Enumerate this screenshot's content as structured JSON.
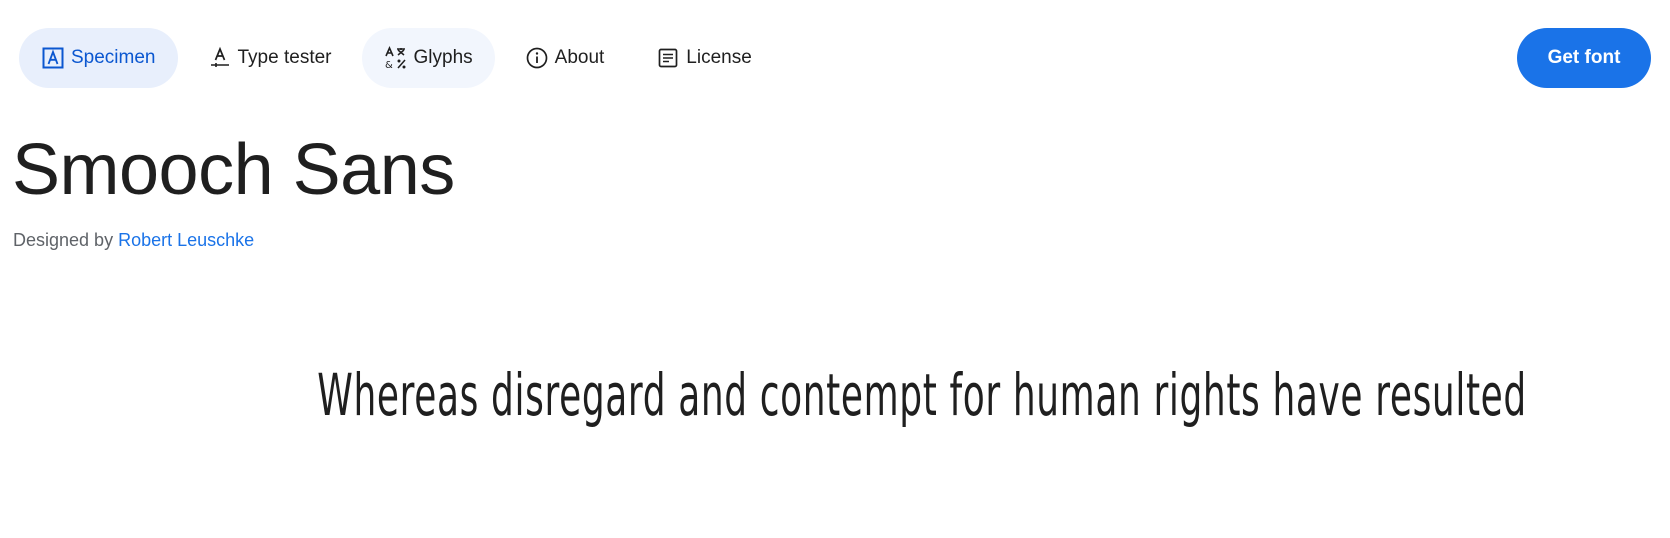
{
  "nav": {
    "tabs": [
      {
        "label": "Specimen",
        "icon": "specimen-icon",
        "active": true
      },
      {
        "label": "Type tester",
        "icon": "type-tester-icon"
      },
      {
        "label": "Glyphs",
        "icon": "glyphs-icon"
      },
      {
        "label": "About",
        "icon": "info-icon"
      },
      {
        "label": "License",
        "icon": "license-icon"
      }
    ],
    "get_font_label": "Get font"
  },
  "font": {
    "name": "Smooch Sans",
    "designed_by_prefix": "Designed by",
    "designer": "Robert Leuschke"
  },
  "specimen": {
    "text": "Whereas disregard and contempt for human rights have resulted"
  },
  "colors": {
    "accent": "#1a73e8",
    "active_tab_bg": "#e8effc",
    "active_tab_text": "#0b57d0"
  }
}
